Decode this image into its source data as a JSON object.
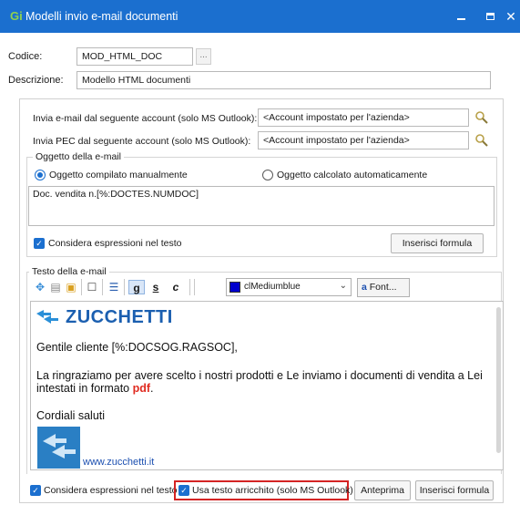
{
  "window": {
    "title": "Modelli invio e-mail documenti",
    "app_icon": "Gi"
  },
  "header": {
    "codice_label": "Codice:",
    "codice_value": "MOD_HTML_DOC",
    "browse_label": "...",
    "descrizione_label": "Descrizione:",
    "descrizione_value": "Modello HTML documenti"
  },
  "accounts": {
    "email_label": "Invia e-mail dal seguente account (solo MS Outlook):",
    "email_value": "<Account impostato per l'azienda>",
    "pec_label": "Invia PEC dal seguente account (solo MS Outlook):",
    "pec_value": "<Account impostato per l'azienda>"
  },
  "oggetto": {
    "legend": "Oggetto della e-mail",
    "radio_manual": "Oggetto compilato manualmente",
    "radio_auto": "Oggetto calcolato automaticamente",
    "selected": "manual",
    "text": "Doc. vendita n.[%:DOCTES.NUMDOC]",
    "consider_label": "Considera espressioni nel testo",
    "insert_formula": "Inserisci formula"
  },
  "testo": {
    "legend": "Testo della e-mail",
    "toolbar": {
      "bold": "g",
      "strike": "s",
      "color_letter": "c",
      "color_name": "clMediumblue",
      "color_hex": "#0000cd",
      "font_label": "Font..."
    },
    "content": {
      "brand": "ZUCCHETTI",
      "greeting": "Gentile cliente [%:DOCSOG.RAGSOC],",
      "body_line1": "La ringraziamo per avere scelto i nostri prodotti e Le inviamo i documenti di vendita a Lei",
      "body_line2_prefix": "intestati in formato ",
      "body_pdf": "pdf",
      "body_line2_suffix": ".",
      "closing": "Cordiali saluti",
      "website": "www.zucchetti.it"
    }
  },
  "footer": {
    "consider_label": "Considera espressioni nel testo",
    "rich_text_label": "Usa testo arricchito (solo MS Outlook)",
    "preview": "Anteprima",
    "insert_formula": "Inserisci formula"
  },
  "colors": {
    "accent": "#1b6fcf",
    "highlight": "#d42424",
    "pdf_text": "#e02b20"
  }
}
